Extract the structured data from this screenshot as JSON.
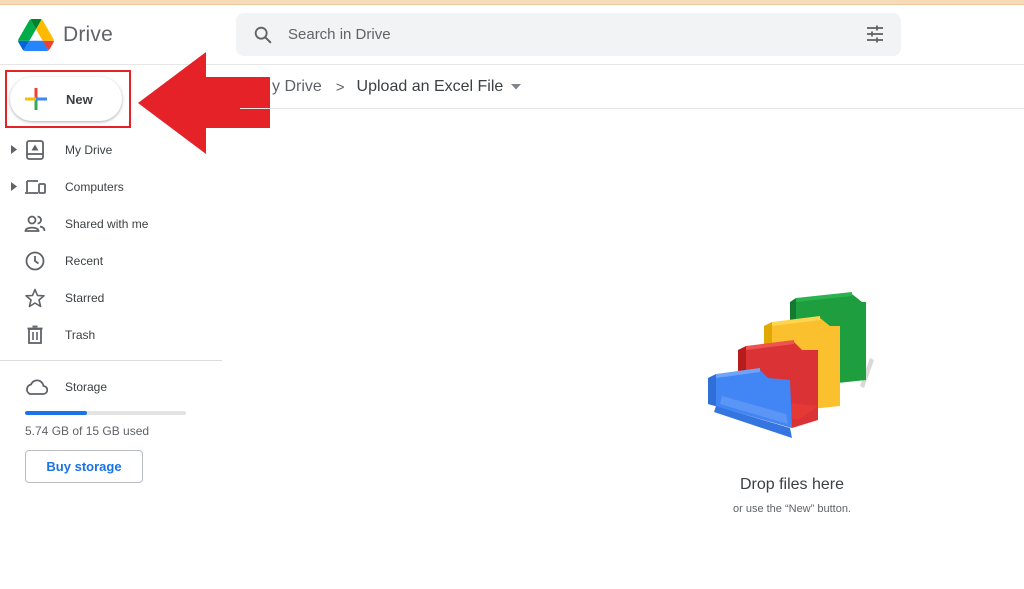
{
  "app": {
    "name": "Drive"
  },
  "search": {
    "placeholder": "Search in Drive",
    "value": ""
  },
  "new_button": {
    "label": "New"
  },
  "sidebar": {
    "items": [
      {
        "label": "My Drive",
        "icon": "my-drive-icon",
        "expandable": true
      },
      {
        "label": "Computers",
        "icon": "computers-icon",
        "expandable": true
      },
      {
        "label": "Shared with me",
        "icon": "shared-icon",
        "expandable": false
      },
      {
        "label": "Recent",
        "icon": "clock-icon",
        "expandable": false
      },
      {
        "label": "Starred",
        "icon": "star-icon",
        "expandable": false
      },
      {
        "label": "Trash",
        "icon": "trash-icon",
        "expandable": false
      }
    ]
  },
  "storage": {
    "label": "Storage",
    "used_text": "5.74 GB of 15 GB used",
    "used_fraction": 0.383,
    "buy_label": "Buy storage"
  },
  "breadcrumb": {
    "root": "My Drive",
    "root_visible": "y Drive",
    "separator": ">",
    "current": "Upload an Excel File"
  },
  "empty_state": {
    "title": "Drop files here",
    "subtitle": "or use the “New” button."
  },
  "colors": {
    "accent": "#1a73e8",
    "annotation_red": "#e52227",
    "folder_blue": "#4285f4",
    "folder_red": "#db3236",
    "folder_yellow": "#fbc02d",
    "folder_green": "#1e9e3e"
  }
}
